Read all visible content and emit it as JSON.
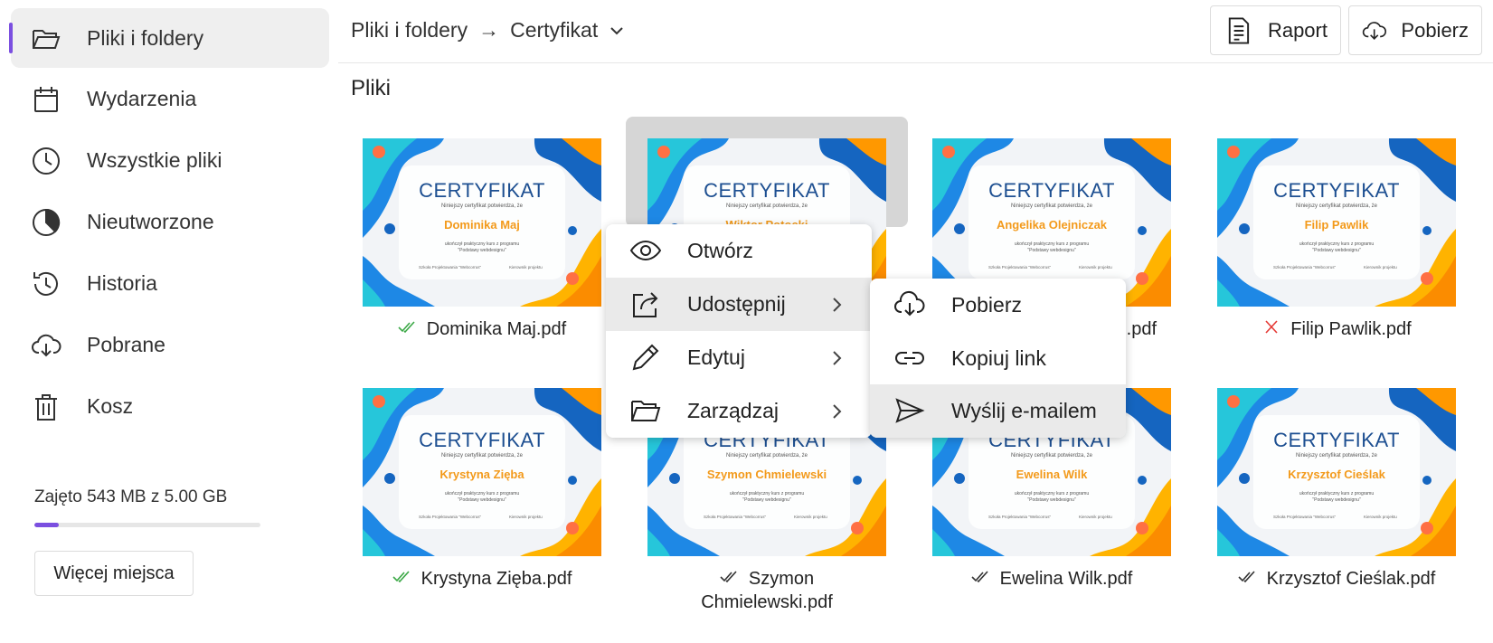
{
  "sidebar": {
    "items": [
      {
        "label": "Pliki i foldery",
        "icon": "folder-open-icon",
        "active": true
      },
      {
        "label": "Wydarzenia",
        "icon": "calendar-icon"
      },
      {
        "label": "Wszystkie pliki",
        "icon": "clock-icon"
      },
      {
        "label": "Nieutworzone",
        "icon": "pie-chart-icon"
      },
      {
        "label": "Historia",
        "icon": "history-icon"
      },
      {
        "label": "Pobrane",
        "icon": "cloud-download-icon"
      },
      {
        "label": "Kosz",
        "icon": "trash-icon"
      }
    ],
    "storage_text": "Zajęto 543 MB z 5.00 GB",
    "storage_fraction": 0.106,
    "more_space_label": "Więcej miejsca"
  },
  "header": {
    "breadcrumb_root": "Pliki i foldery",
    "breadcrumb_sep": "→",
    "breadcrumb_current": "Certyfikat",
    "raport_label": "Raport",
    "pobierz_label": "Pobierz"
  },
  "section_title": "Pliki",
  "certificate": {
    "title": "CERTYFIKAT",
    "subtitle": "Niniejszy certyfikat potwierdza, że",
    "line1": "ukończył praktyczny kurs z programu",
    "line2": "\"Podstawy webdesignu\"",
    "sig1": "Szkoła Projektowania \"Webcorrus\"",
    "sig2": "Kierownik projektu"
  },
  "files": [
    {
      "name": "Dominika Maj",
      "caption": "Dominika Maj.pdf",
      "status": "double-check-green"
    },
    {
      "name": "Wiktor Potocki",
      "caption": "",
      "status": "none"
    },
    {
      "name": "Angelika Olejniczak",
      "caption": ".pdf",
      "status": "none"
    },
    {
      "name": "Filip Pawlik",
      "caption": "Filip Pawlik.pdf",
      "status": "cross-red"
    },
    {
      "name": "Krystyna Zięba",
      "caption": "Krystyna Zięba.pdf",
      "status": "double-check-green"
    },
    {
      "name": "Szymon Chmielewski",
      "caption": "Szymon\nChmielewski.pdf",
      "status": "double-check-dark"
    },
    {
      "name": "Ewelina Wilk",
      "caption": "Ewelina Wilk.pdf",
      "status": "double-check-dark"
    },
    {
      "name": "Krzysztof Cieślak",
      "caption": "Krzysztof Cieślak.pdf",
      "status": "double-check-dark"
    }
  ],
  "context_menu": {
    "items": [
      {
        "label": "Otwórz",
        "icon": "eye-icon",
        "submenu": false
      },
      {
        "label": "Udostępnij",
        "icon": "share-icon",
        "submenu": true,
        "hover": true
      },
      {
        "label": "Edytuj",
        "icon": "pencil-icon",
        "submenu": true
      },
      {
        "label": "Zarządzaj",
        "icon": "folder-icon",
        "submenu": true
      }
    ]
  },
  "submenu": {
    "items": [
      {
        "label": "Pobierz",
        "icon": "cloud-download-icon"
      },
      {
        "label": "Kopiuj link",
        "icon": "link-icon"
      },
      {
        "label": "Wyślij e-mailem",
        "icon": "send-icon",
        "hover": true
      }
    ]
  },
  "colors": {
    "accent": "#7b4fe0",
    "cert_title": "#1d4f91",
    "cert_name": "#f39a1b",
    "status_green": "#3aa845",
    "status_red": "#e53935"
  }
}
